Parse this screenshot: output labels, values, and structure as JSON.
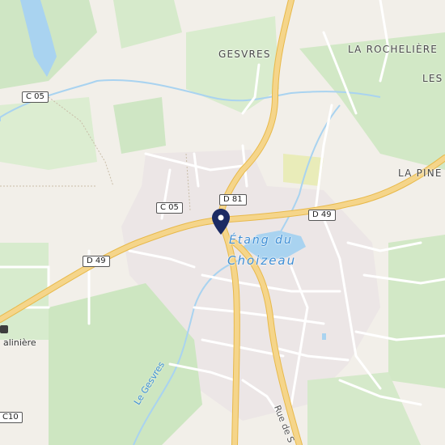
{
  "map": {
    "place_labels": {
      "gesvres": "GESVRES",
      "la_rocheliere": "LA ROCHELIÈRE",
      "les": "LES",
      "la_pine": "LA PINE"
    },
    "road_labels": {
      "c05_top": "C 05",
      "c05_mid": "C 05",
      "d81": "D 81",
      "d49_right": "D 49",
      "d49_left": "D 49",
      "c10": "C10"
    },
    "water_labels": {
      "etang_line1": "Étang du",
      "etang_line2": "Choizeau",
      "stream": "Le Gesvres"
    },
    "street_labels": {
      "rue": "Rue de S"
    },
    "poi": {
      "bus_stop": "alinière"
    },
    "marker_icon": "location-pin-icon",
    "colors": {
      "background": "#f2efe9",
      "green": "#cfe6c4",
      "water": "#a9d3f0",
      "major_road": "#f5d58a",
      "major_road_casing": "#e8b94a",
      "minor_road": "#ffffff",
      "marker": "#1b2a63",
      "town_area": "#ece6e6"
    }
  }
}
